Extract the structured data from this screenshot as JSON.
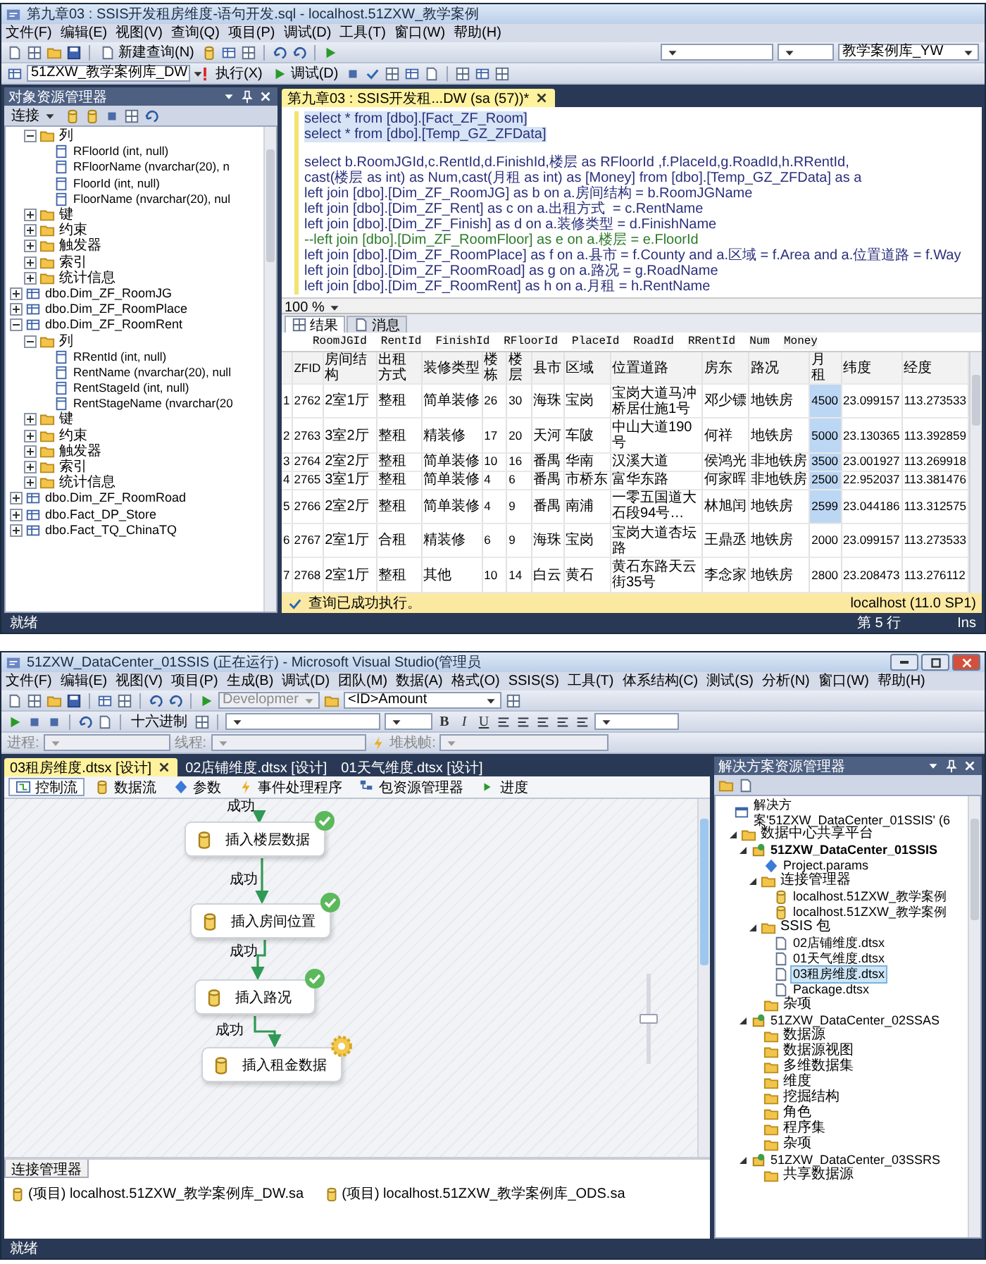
{
  "ssms_window": {
    "title": "第九章03 : SSIS开发租房维度-语句开发.sql - localhost.51ZXW_教学案例",
    "menu": [
      "文件(F)",
      "编辑(E)",
      "视图(V)",
      "查询(Q)",
      "项目(P)",
      "调试(D)",
      "工具(T)",
      "窗口(W)",
      "帮助(H)"
    ],
    "toolbar": {
      "new_query": "新建查询(N)",
      "solution_database": "教学案例库_YW",
      "database": "51ZXW_教学案例库_DW",
      "execute": "执行(X)",
      "debug": "调试(D)"
    },
    "object_explorer": {
      "title": "对象资源管理器",
      "connect": "连接",
      "continued_items": [
        {
          "label": "列",
          "kind": "folder",
          "expanded": true,
          "children": [
            {
              "label": "RFloorId (int, null)",
              "kind": "column"
            },
            {
              "label": "RFloorName (nvarchar(20), n",
              "kind": "column"
            },
            {
              "label": "FloorId (int, null)",
              "kind": "column"
            },
            {
              "label": "FloorName (nvarchar(20), nul",
              "kind": "column"
            }
          ]
        },
        {
          "label": "键",
          "kind": "folder",
          "expanded": false
        },
        {
          "label": "约束",
          "kind": "folder",
          "expanded": false
        },
        {
          "label": "触发器",
          "kind": "folder",
          "expanded": false
        },
        {
          "label": "索引",
          "kind": "folder",
          "expanded": false
        },
        {
          "label": "统计信息",
          "kind": "folder",
          "expanded": false
        }
      ],
      "items": [
        {
          "label": "dbo.Dim_ZF_RoomJG",
          "kind": "table",
          "expanded": false
        },
        {
          "label": "dbo.Dim_ZF_RoomPlace",
          "kind": "table",
          "expanded": false
        },
        {
          "label": "dbo.Dim_ZF_RoomRent",
          "kind": "table",
          "expanded": true,
          "children": [
            {
              "label": "列",
              "kind": "folder",
              "expanded": true,
              "children": [
                {
                  "label": "RRentId (int, null)",
                  "kind": "column"
                },
                {
                  "label": "RentName (nvarchar(20), null",
                  "kind": "column"
                },
                {
                  "label": "RentStageId (int, null)",
                  "kind": "column"
                },
                {
                  "label": "RentStageName (nvarchar(20",
                  "kind": "column"
                }
              ]
            },
            {
              "label": "键",
              "kind": "folder",
              "expanded": false
            },
            {
              "label": "约束",
              "kind": "folder",
              "expanded": false
            },
            {
              "label": "触发器",
              "kind": "folder",
              "expanded": false
            },
            {
              "label": "索引",
              "kind": "folder",
              "expanded": false
            },
            {
              "label": "统计信息",
              "kind": "folder",
              "expanded": false
            }
          ]
        },
        {
          "label": "dbo.Dim_ZF_RoomRoad",
          "kind": "table",
          "expanded": false
        },
        {
          "label": "dbo.Fact_DP_Store",
          "kind": "table",
          "expanded": false
        },
        {
          "label": "dbo.Fact_TQ_ChinaTQ",
          "kind": "table",
          "expanded": false
        }
      ]
    },
    "editor": {
      "tab": "第九章03 : SSIS开发租...DW (sa (57))*",
      "zoom": "100 %",
      "lines": [
        {
          "text": "select * from [dbo].[Fact_ZF_Room]",
          "kind": "code",
          "selected": true
        },
        {
          "text": "select * from [dbo].[Temp_GZ_ZFData]",
          "kind": "code",
          "selected": true
        },
        {
          "text": "select b.RoomJGId,c.RentId,d.FinishId,楼层 as RFloorId ,f.PlaceId,g.RoadId,h.RRentId,",
          "kind": "code",
          "selected": false,
          "gap_before": true
        },
        {
          "text": "cast(楼层 as int) as Num,cast(月租 as int) as [Money] from [dbo].[Temp_GZ_ZFData] as a",
          "kind": "code",
          "selected": false
        },
        {
          "text": "left join [dbo].[Dim_ZF_RoomJG] as b on a.房间结构 = b.RoomJGName",
          "kind": "code",
          "selected": false
        },
        {
          "text": "left join [dbo].[Dim_ZF_Rent] as c on a.出租方式  = c.RentName",
          "kind": "code",
          "selected": false
        },
        {
          "text": "left join [dbo].[Dim_ZF_Finish] as d on a.装修类型 = d.FinishName",
          "kind": "code",
          "selected": false
        },
        {
          "text": "--left join [dbo].[Dim_ZF_RoomFloor] as e on a.楼层 = e.FloorId",
          "kind": "comment",
          "selected": false
        },
        {
          "text": "left join [dbo].[Dim_ZF_RoomPlace] as f on a.县市 = f.County and a.区域 = f.Area and a.位置道路 = f.Way",
          "kind": "code",
          "selected": false
        },
        {
          "text": "left join [dbo].[Dim_ZF_RoomRoad] as g on a.路况 = g.RoadName",
          "kind": "code",
          "selected": false
        },
        {
          "text": "left join [dbo].[Dim_ZF_RoomRent] as h on a.月租 = h.RentName",
          "kind": "code",
          "selected": false
        }
      ]
    },
    "results": {
      "tabs": [
        {
          "label": "结果",
          "selected": true
        },
        {
          "label": "消息",
          "selected": false
        }
      ],
      "first_grid_columns": [
        "RoomJGId",
        "RentId",
        "FinishId",
        "RFloorId",
        "PlaceId",
        "RoadId",
        "RRentId",
        "Num",
        "Money"
      ],
      "grid": {
        "columns": [
          "ZFID",
          "房间结构",
          "出租方式",
          "装修类型",
          "楼栋",
          "楼层",
          "县市",
          "区域",
          "位置道路",
          "房东",
          "路况",
          "月租",
          "纬度",
          "经度"
        ],
        "rows": [
          {
            "number": "1",
            "cells": [
              "2762",
              "2室1厅",
              "整租",
              "简单装修",
              "26",
              "30",
              "海珠",
              "宝岗",
              "宝岗大道马冲桥居仕施1号",
              "邓少镖",
              "地铁房",
              {
                "text": "4500",
                "selected": true
              },
              "23.099157",
              "113.273533"
            ]
          },
          {
            "number": "2",
            "cells": [
              "2763",
              "3室2厅",
              "整租",
              "精装修",
              "17",
              "20",
              "天河",
              "车陂",
              "中山大道190号",
              "何祥",
              "地铁房",
              {
                "text": "5000",
                "selected": true
              },
              "23.130365",
              "113.392859"
            ]
          },
          {
            "number": "3",
            "cells": [
              "2764",
              "2室2厅",
              "整租",
              "简单装修",
              "10",
              "16",
              "番禺",
              "华南",
              "汉溪大道",
              "侯鸿光",
              "非地铁房",
              {
                "text": "3500",
                "selected": true
              },
              "23.001927",
              "113.269918"
            ]
          },
          {
            "number": "4",
            "cells": [
              "2765",
              "3室1厅",
              "整租",
              "简单装修",
              "4",
              "6",
              "番禺",
              "市桥东",
              "富华东路",
              "何家晖",
              "非地铁房",
              {
                "text": "2500",
                "selected": true
              },
              "22.952037",
              "113.381476"
            ]
          },
          {
            "number": "5",
            "cells": [
              "2766",
              "2室2厅",
              "整租",
              "简单装修",
              "4",
              "9",
              "番禺",
              "南浦",
              "一零五国道大石段94号…",
              "林旭闰",
              "地铁房",
              {
                "text": "2599",
                "selected": true
              },
              "23.044186",
              "113.312575"
            ]
          },
          {
            "number": "6",
            "cells": [
              "2767",
              "2室1厅",
              "合租",
              "精装修",
              "6",
              "9",
              "海珠",
              "宝岗",
              "宝岗大道杏坛路",
              "王鼎丞",
              "地铁房",
              {
                "text": "2000",
                "selected": false
              },
              "23.099157",
              "113.273533"
            ]
          },
          {
            "number": "7",
            "cells": [
              "2768",
              "2室1厅",
              "整租",
              "其他",
              "10",
              "14",
              "白云",
              "黄石",
              "黄石东路天云街35号",
              "李念家",
              "地铁房",
              {
                "text": "2800",
                "selected": false
              },
              "23.208473",
              "113.276112"
            ]
          }
        ]
      },
      "message": "查询已成功执行。",
      "server": "localhost (11.0 SP1)"
    },
    "status_bar": {
      "state": "就绪",
      "line": "第 5 行",
      "mode": "Ins"
    }
  },
  "vs_window": {
    "title": "51ZXW_DataCenter_01SSIS (正在运行) - Microsoft Visual Studio(管理员",
    "menu": [
      "文件(F)",
      "编辑(E)",
      "视图(V)",
      "项目(P)",
      "生成(B)",
      "调试(D)",
      "团队(M)",
      "数据(A)",
      "格式(O)",
      "SSIS(S)",
      "工具(T)",
      "体系结构(C)",
      "测试(S)",
      "分析(N)",
      "窗口(W)",
      "帮助(H)"
    ],
    "toolbar": {
      "configuration": "Developmer",
      "find": "<ID>Amount",
      "hex": "十六进制",
      "format_buttons": [
        "B",
        "I",
        "U"
      ],
      "process": "进程:",
      "thread": "线程:",
      "stack_frame": "堆栈帧:"
    },
    "document_tabs": [
      {
        "label": "03租房维度.dtsx [设计]",
        "selected": true
      },
      {
        "label": "02店铺维度.dtsx [设计]",
        "selected": false
      },
      {
        "label": "01天气维度.dtsx [设计]",
        "selected": false
      }
    ],
    "designer_tabs": [
      {
        "label": "控制流",
        "selected": true
      },
      {
        "label": "数据流",
        "selected": false
      },
      {
        "label": "参数",
        "selected": false
      },
      {
        "label": "事件处理程序",
        "selected": false
      },
      {
        "label": "包资源管理器",
        "selected": false
      },
      {
        "label": "进度",
        "selected": false
      }
    ],
    "designer": {
      "tasks": [
        {
          "label": "插入楼层数据",
          "kind": "succeeded"
        },
        {
          "label": "插入房间位置",
          "kind": "succeeded"
        },
        {
          "label": "插入路况",
          "kind": "succeeded"
        },
        {
          "label": "插入租金数据",
          "kind": "running"
        }
      ],
      "connectors": [
        {
          "label": "成功"
        },
        {
          "label": "成功"
        },
        {
          "label": "成功"
        },
        {
          "label": "成功"
        }
      ],
      "zoom_slider": {
        "level": 0.5
      }
    },
    "connection_manager": {
      "tab": "连接管理器",
      "items": [
        "(项目) localhost.51ZXW_教学案例库_DW.sa",
        "(项目) localhost.51ZXW_教学案例库_ODS.sa"
      ]
    },
    "solution_explorer": {
      "title": "解决方案资源管理器",
      "items": [
        {
          "label": "解决方案'51ZXW_DataCenter_01SSIS' (6",
          "kind": "solution",
          "selected": false,
          "children": [
            {
              "label": "数据中心共享平台",
              "kind": "folder",
              "expanded": true,
              "selected": false,
              "children": [
                {
                  "label": "51ZXW_DataCenter_01SSIS",
                  "kind": "startup_project",
                  "expanded": true,
                  "selected": false,
                  "children": [
                    {
                      "label": "Project.params",
                      "kind": "params",
                      "selected": false
                    },
                    {
                      "label": "连接管理器",
                      "kind": "folder",
                      "expanded": true,
                      "selected": false,
                      "children": [
                        {
                          "label": "localhost.51ZXW_教学案例",
                          "kind": "connection",
                          "selected": false
                        },
                        {
                          "label": "localhost.51ZXW_教学案例",
                          "kind": "connection",
                          "selected": false
                        }
                      ]
                    },
                    {
                      "label": "SSIS 包",
                      "kind": "folder",
                      "expanded": true,
                      "selected": false,
                      "children": [
                        {
                          "label": "02店铺维度.dtsx",
                          "kind": "package",
                          "selected": false
                        },
                        {
                          "label": "01天气维度.dtsx",
                          "kind": "package",
                          "selected": false
                        },
                        {
                          "label": "03租房维度.dtsx",
                          "kind": "package",
                          "selected": true
                        },
                        {
                          "label": "Package.dtsx",
                          "kind": "package",
                          "selected": false
                        }
                      ]
                    },
                    {
                      "label": "杂项",
                      "kind": "folder",
                      "selected": false
                    }
                  ]
                },
                {
                  "label": "51ZXW_DataCenter_02SSAS",
                  "kind": "project",
                  "expanded": true,
                  "selected": false,
                  "children": [
                    {
                      "label": "数据源",
                      "kind": "folder",
                      "selected": false
                    },
                    {
                      "label": "数据源视图",
                      "kind": "folder",
                      "selected": false
                    },
                    {
                      "label": "多维数据集",
                      "kind": "folder",
                      "selected": false
                    },
                    {
                      "label": "维度",
                      "kind": "folder",
                      "selected": false
                    },
                    {
                      "label": "挖掘结构",
                      "kind": "folder",
                      "selected": false
                    },
                    {
                      "label": "角色",
                      "kind": "folder",
                      "selected": false
                    },
                    {
                      "label": "程序集",
                      "kind": "folder",
                      "selected": false
                    },
                    {
                      "label": "杂项",
                      "kind": "folder",
                      "selected": false
                    }
                  ]
                },
                {
                  "label": "51ZXW_DataCenter_03SSRS",
                  "kind": "project",
                  "expanded": true,
                  "selected": false,
                  "children": [
                    {
                      "label": "共享数据源",
                      "kind": "folder",
                      "selected": false
                    }
                  ]
                }
              ]
            }
          ]
        }
      ]
    },
    "status_bar": {
      "state": "就绪"
    }
  }
}
